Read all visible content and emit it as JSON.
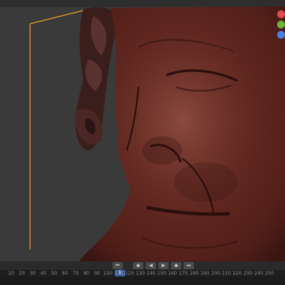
{
  "timeline": {
    "ruler_ticks": [
      "10",
      "20",
      "30",
      "40",
      "50",
      "60",
      "70",
      "80",
      "90",
      "100",
      "110",
      "120",
      "130",
      "140",
      "150",
      "160",
      "170",
      "180",
      "190",
      "200",
      "210",
      "220",
      "230",
      "240",
      "250"
    ],
    "current_frame": "1",
    "controls": [
      "jump-start",
      "prev-key",
      "play-reverse",
      "play",
      "next-key",
      "jump-end"
    ],
    "control_glyphs": [
      "⏮",
      "◆",
      "◀",
      "▶",
      "◆",
      "⏭"
    ]
  },
  "colors": {
    "bounds_box": "#e39a2a",
    "mesh": "#8a3a2f",
    "gizmo_dots": [
      "#e04b4b",
      "#6fb13a",
      "#4b7fe0"
    ]
  }
}
